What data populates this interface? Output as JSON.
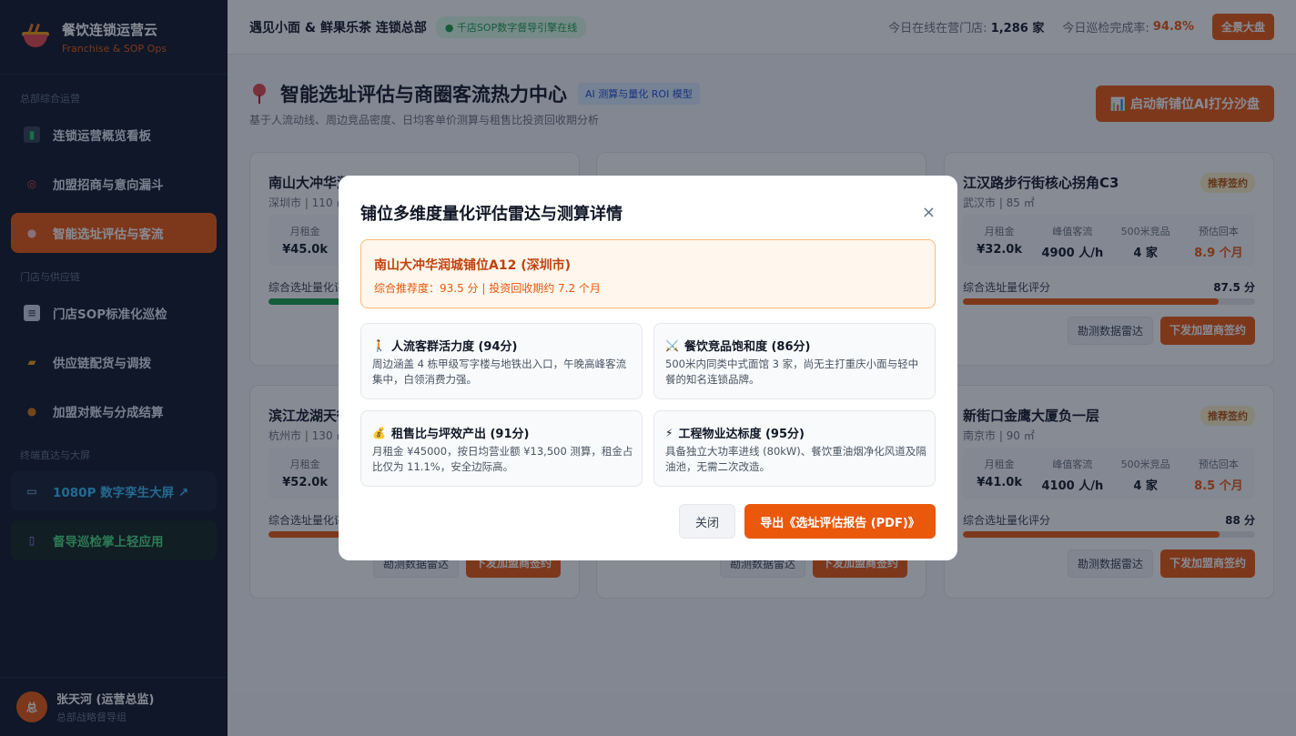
{
  "brand": {
    "title": "餐饮连锁运营云",
    "subtitle": "Franchise & SOP Ops"
  },
  "sidebar": {
    "sections": [
      "总部综合运营",
      "门店与供应链",
      "终端直达与大屏"
    ],
    "items": [
      {
        "label": "连锁运营概览看板",
        "icon": "chart-icon"
      },
      {
        "label": "加盟招商与意向漏斗",
        "icon": "target-icon"
      },
      {
        "label": "智能选址评估与客流",
        "icon": "pin-icon"
      },
      {
        "label": "门店SOP标准化巡检",
        "icon": "clipboard-icon"
      },
      {
        "label": "供应链配货与调拨",
        "icon": "truck-icon"
      },
      {
        "label": "加盟对账与分成结算",
        "icon": "money-bag-icon"
      },
      {
        "label": "1080P 数字孪生大屏 ↗",
        "icon": "monitor-icon"
      },
      {
        "label": "督导巡检掌上轻应用",
        "icon": "phone-icon"
      }
    ]
  },
  "user": {
    "avatar": "总",
    "name": "张天河 (运营总监)",
    "role": "总部战略督导组"
  },
  "topbar": {
    "title": "遇见小面 & 鲜果乐茶 连锁总部",
    "badge": "● 千店SOP数字督导引擎在线",
    "online_label": "今日在线在营门店:",
    "online_value": "1,286 家",
    "rate_label": "今日巡检完成率:",
    "rate_value": "94.8%",
    "button": "全景大盘"
  },
  "page": {
    "title": "智能选址评估与商圈客流热力中心",
    "badge": "AI 测算与量化 ROI 模型",
    "subtitle": "基于人流动线、周边竞品密度、日均客单价测算与租售比投资回收期分析",
    "button": "📊 启动新铺位AI打分沙盘"
  },
  "cards": [
    {
      "title": "南山大冲华润城铺位A12",
      "tag": "",
      "meta": "深圳市 | 110 ㎡",
      "stats": [
        {
          "label": "月租金",
          "value": "¥45.0k"
        },
        {
          "label": "",
          "value": ""
        },
        {
          "label": "",
          "value": ""
        },
        {
          "label": "",
          "value": ""
        }
      ],
      "score_label": "综合选址量化评分",
      "score_value": "",
      "score": 93.5
    },
    {
      "title": "",
      "tag": "",
      "meta": "",
      "stats": [],
      "score_label": "",
      "score_value": "",
      "score": 0
    },
    {
      "title": "江汉路步行街核心拐角C3",
      "tag": "推荐签约",
      "meta": "武汉市 | 85 ㎡",
      "stats": [
        {
          "label": "月租金",
          "value": "¥32.0k"
        },
        {
          "label": "峰值客流",
          "value": "4900 人/h"
        },
        {
          "label": "500米竞品",
          "value": "4 家"
        },
        {
          "label": "预估回本",
          "value": "8.9 个月"
        }
      ],
      "score_label": "综合选址量化评分",
      "score_value": "87.5 分",
      "score": 87.5
    },
    {
      "title": "滨江龙湖天街",
      "tag": "",
      "meta": "杭州市 | 130 ㎡",
      "stats": [
        {
          "label": "月租金",
          "value": "¥52.0k"
        },
        {
          "label": "",
          "value": ""
        },
        {
          "label": "",
          "value": ""
        },
        {
          "label": "",
          "value": ""
        }
      ],
      "score_label": "综合选址量化评分",
      "score_value": "",
      "score": 70
    },
    {
      "title": "",
      "tag": "",
      "meta": "",
      "stats": [],
      "score_label": "",
      "score_value": "",
      "score": 0
    },
    {
      "title": "新街口金鹰大厦负一层",
      "tag": "推荐签约",
      "meta": "南京市 | 90 ㎡",
      "stats": [
        {
          "label": "月租金",
          "value": "¥41.0k"
        },
        {
          "label": "峰值客流",
          "value": "4100 人/h"
        },
        {
          "label": "500米竞品",
          "value": "4 家"
        },
        {
          "label": "预估回本",
          "value": "8.5 个月"
        }
      ],
      "score_label": "综合选址量化评分",
      "score_value": "88 分",
      "score": 88
    }
  ],
  "card_buttons": {
    "radar": "勘测数据雷达",
    "sign": "下发加盟商签约"
  },
  "modal": {
    "title": "铺位多维度量化评估雷达与测算详情",
    "close": "×",
    "highlight_title": "南山大冲华润城铺位A12 (深圳市)",
    "highlight_sub": "综合推荐度：93.5 分 | 投资回收期约 7.2 个月",
    "boxes": [
      {
        "icon": "🚶",
        "title": "人流客群活力度 (94分)",
        "body": "周边涵盖 4 栋甲级写字楼与地铁出入口，午晚高峰客流集中，白领消费力强。"
      },
      {
        "icon": "⚔️",
        "title": "餐饮竞品饱和度 (86分)",
        "body": "500米内同类中式面馆 3 家，尚无主打重庆小面与轻中餐的知名连锁品牌。"
      },
      {
        "icon": "💰",
        "title": "租售比与坪效产出 (91分)",
        "body": "月租金 ¥45000，按日均营业额 ¥13,500 测算，租金占比仅为 11.1%，安全边际高。"
      },
      {
        "icon": "⚡",
        "title": "工程物业达标度 (95分)",
        "body": "具备独立大功率进线 (80kW)、餐饮重油烟净化风道及隔油池，无需二次改造。"
      }
    ],
    "cancel": "关闭",
    "export": "导出《选址评估报告 (PDF)》"
  }
}
